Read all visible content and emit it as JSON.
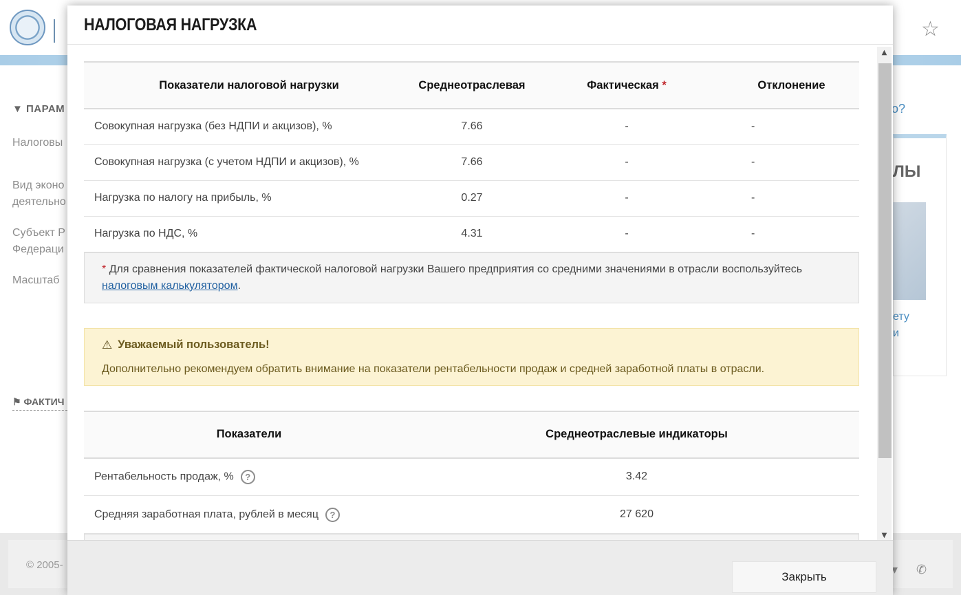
{
  "background": {
    "left_labels": [
      "Налоговы",
      "Вид эконо",
      "деятельно",
      "Субъект Р",
      "Федераци",
      "Масштаб"
    ],
    "params_label": "ПАРАМ",
    "fact_label": "ФАКТИЧ",
    "right_question": "о?",
    "right_title": "ЛЫ",
    "right_links": [
      "ету",
      "и"
    ],
    "copyright": "© 2005-"
  },
  "modal": {
    "title": "НАЛОГОВАЯ НАГРУЗКА",
    "tax_table": {
      "headers": {
        "indicator": "Показатели налоговой нагрузки",
        "average": "Среднеотраслевая",
        "actual": "Фактическая",
        "actual_marker": "*",
        "deviation": "Отклонение"
      },
      "rows": [
        {
          "label": "Совокупная нагрузка (без НДПИ и акцизов), %",
          "average": "7.66",
          "actual": "-",
          "deviation": "-"
        },
        {
          "label": "Совокупная нагрузка (с учетом НДПИ и акцизов), %",
          "average": "7.66",
          "actual": "-",
          "deviation": "-"
        },
        {
          "label": "Нагрузка по налогу на прибыль, %",
          "average": "0.27",
          "actual": "-",
          "deviation": "-"
        },
        {
          "label": "Нагрузка по НДС, %",
          "average": "4.31",
          "actual": "-",
          "deviation": "-"
        }
      ]
    },
    "note": {
      "marker": "*",
      "text_before": "Для сравнения показателей фактической налоговой нагрузки Вашего предприятия со средними значениями в отрасли воспользуйтесь",
      "link_text": "налоговым калькулятором",
      "text_after": "."
    },
    "warning": {
      "title": "Уважаемый пользователь!",
      "text": "Дополнительно рекомендуем обратить внимание на показатели рентабельности продаж и средней заработной платы в отрасли."
    },
    "indicators_table": {
      "headers": {
        "indicator": "Показатели",
        "average": "Среднеотраслевые индикаторы"
      },
      "rows": [
        {
          "label": "Рентабельность продаж, %",
          "value": "3.42"
        },
        {
          "label": "Средняя заработная плата, рублей в месяц",
          "value": "27 620"
        }
      ]
    },
    "close_label": "Закрыть"
  }
}
